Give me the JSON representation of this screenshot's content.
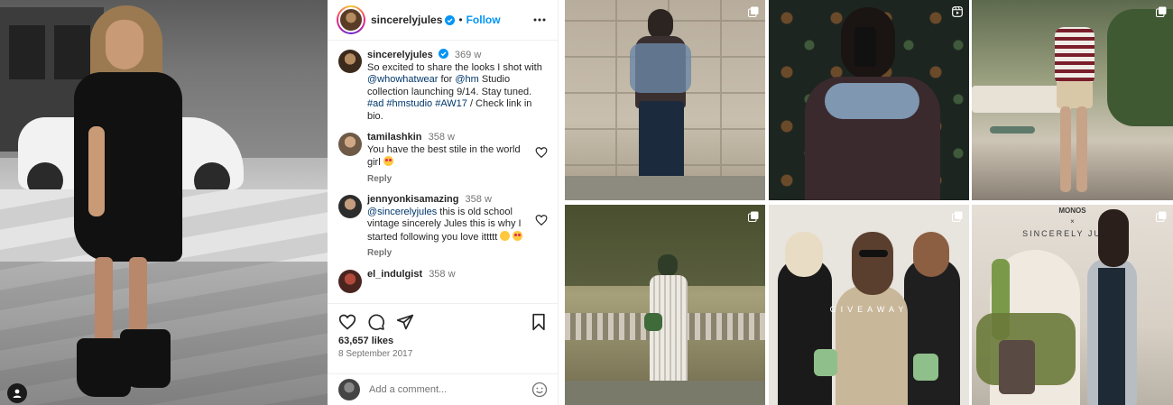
{
  "post": {
    "username": "sincerelyjules",
    "follow_label": "Follow",
    "caption": {
      "username": "sincerelyjules",
      "time": "369 w",
      "text_1": "So excited to share the looks I shot with ",
      "mention_1": "@whowhatwear",
      "text_2": " for ",
      "mention_2": "@hm",
      "text_3": " Studio collection launching 9/14. Stay tuned. ",
      "hashtags": "#ad #hmstudio #AW17",
      "text_4": " / Check link in bio."
    },
    "comments": [
      {
        "username": "tamilashkin",
        "time": "358 w",
        "text": "You have the best stile in the world girl",
        "reply_label": "Reply"
      },
      {
        "username": "jennyonkisamazing",
        "time": "358 w",
        "mention": "@sincerelyjules",
        "text": " this is old school vintage sincerely Jules this is why I started following you love ittttt",
        "reply_label": "Reply"
      },
      {
        "username": "el_indulgist",
        "time": "358 w"
      }
    ],
    "likes": "63,657 likes",
    "date": "8 September 2017",
    "add_comment_placeholder": "Add a comment..."
  },
  "grid": {
    "tile_5_text": "GIVEAWAY",
    "tile_6_top": "MONOS",
    "tile_6_x": "×",
    "tile_6_text": "SINCERELY JULES"
  },
  "colors": {
    "accent": "#0095f6",
    "verified": "#0095f6",
    "mention": "#00376b",
    "secondary_text": "#737373"
  },
  "icons": {
    "header": [
      "verified-icon",
      "more-icon"
    ],
    "actions": [
      "heart-icon",
      "comment-icon",
      "share-icon",
      "bookmark-icon"
    ],
    "grid_badges": [
      "multiple-posts-icon",
      "reels-icon"
    ]
  }
}
